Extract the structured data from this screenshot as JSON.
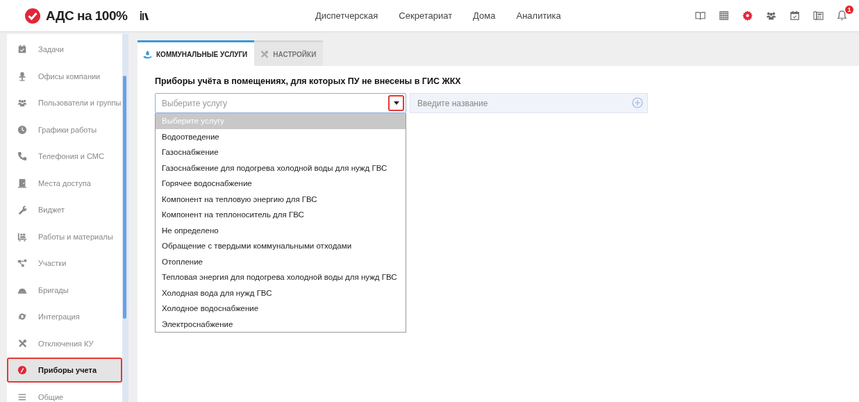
{
  "header": {
    "logo": "АДС на 100%",
    "nav": [
      {
        "label": "Диспетчерская"
      },
      {
        "label": "Секретариат"
      },
      {
        "label": "Дома"
      },
      {
        "label": "Аналитика"
      }
    ],
    "tools": [
      {
        "kind": "book",
        "active": false
      },
      {
        "kind": "calendar",
        "active": false
      },
      {
        "kind": "gear",
        "active": true
      },
      {
        "kind": "people",
        "active": false
      },
      {
        "kind": "check-calendar",
        "active": false
      },
      {
        "kind": "phone",
        "active": false
      },
      {
        "kind": "bell",
        "active": false,
        "badge": "1"
      }
    ]
  },
  "sidebar": {
    "items": [
      {
        "label": "Задачи",
        "kind": "calendar",
        "selected": false
      },
      {
        "label": "Офисы компании",
        "kind": "chair",
        "selected": false
      },
      {
        "label": "Пользователи и группы",
        "kind": "people",
        "selected": false
      },
      {
        "label": "Графики работы",
        "kind": "clock",
        "selected": false
      },
      {
        "label": "Телефония и СМС",
        "kind": "phone",
        "selected": false
      },
      {
        "label": "Места доступа",
        "kind": "door",
        "selected": false
      },
      {
        "label": "Виджет",
        "kind": "wrench",
        "selected": false
      },
      {
        "label": "Работы и материалы",
        "kind": "cart",
        "selected": false
      },
      {
        "label": "Участки",
        "kind": "nodes",
        "selected": false
      },
      {
        "label": "Бригады",
        "kind": "helmet",
        "selected": false
      },
      {
        "label": "Интеграция",
        "kind": "sync",
        "selected": false
      },
      {
        "label": "Отключения КУ",
        "kind": "tools",
        "selected": false
      },
      {
        "label": "Приборы учета",
        "kind": "gauge",
        "selected": true
      },
      {
        "label": "Общие",
        "kind": "lines",
        "selected": false
      }
    ]
  },
  "tabs": [
    {
      "label": "КОММУНАЛЬНЫЕ УСЛУГИ",
      "kind": "hand",
      "selected": true
    },
    {
      "label": "НАСТРОЙКИ",
      "kind": "tools",
      "selected": false
    }
  ],
  "section_title": "Приборы учёта в помещениях, для которых ПУ не внесены в ГИС ЖКХ",
  "service_select": {
    "placeholder": "Выберите услугу",
    "expanded": true,
    "options": [
      {
        "label": "Выберите услугу",
        "selected": true
      },
      {
        "label": "Водоотведение",
        "selected": false
      },
      {
        "label": "Газоснабжение",
        "selected": false
      },
      {
        "label": "Газоснабжение для подогрева холодной воды для нужд ГВС",
        "selected": false
      },
      {
        "label": "Горячее водоснабжение",
        "selected": false
      },
      {
        "label": "Компонент на тепловую энергию для ГВС",
        "selected": false
      },
      {
        "label": "Компонент на теплоноситель для ГВС",
        "selected": false
      },
      {
        "label": "Не определено",
        "selected": false
      },
      {
        "label": "Обращение с твердыми коммунальными отходами",
        "selected": false
      },
      {
        "label": "Отопление",
        "selected": false
      },
      {
        "label": "Тепловая энергия для подогрева холодной воды для нужд ГВС",
        "selected": false
      },
      {
        "label": "Холодная вода для нужд ГВС",
        "selected": false
      },
      {
        "label": "Холодное водоснабжение",
        "selected": false
      },
      {
        "label": "Электроснабжение",
        "selected": false
      }
    ]
  },
  "name_field": {
    "placeholder": "Введите название"
  }
}
